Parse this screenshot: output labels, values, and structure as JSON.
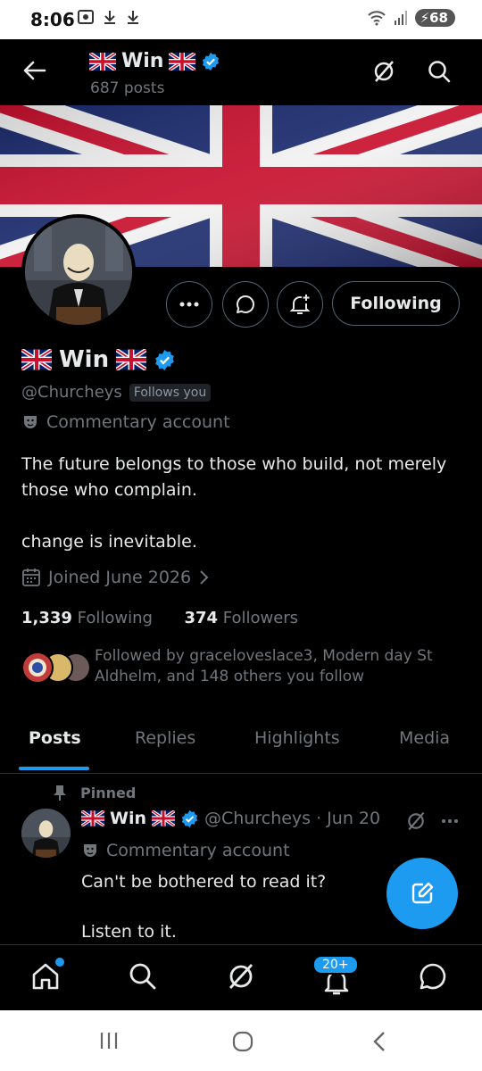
{
  "status_bar": {
    "time": "8:06",
    "battery": "68",
    "icons": [
      "screenshot-icon",
      "download-icon",
      "download-icon",
      "wifi-icon",
      "signal-icon",
      "battery-icon"
    ]
  },
  "header": {
    "name": "Win",
    "posts_count": "687 posts"
  },
  "profile": {
    "display_name": "Win",
    "handle": "@Churcheys",
    "follows_you": "Follows you",
    "category": "Commentary account",
    "bio_line1": "The future belongs to those who build, not merely those who complain.",
    "bio_line2": "change is inevitable.",
    "joined": "Joined June 2026",
    "following_count": "1,339",
    "following_label": "Following",
    "followers_count": "374",
    "followers_label": "Followers",
    "followed_by": "Followed by graceloveslace3, Modern day St Aldhelm, and 148 others you follow"
  },
  "actions": {
    "following_button": "Following"
  },
  "tabs": [
    {
      "label": "Posts",
      "active": true
    },
    {
      "label": "Replies",
      "active": false
    },
    {
      "label": "Highlights",
      "active": false
    },
    {
      "label": "Media",
      "active": false
    }
  ],
  "post": {
    "pinned_label": "Pinned",
    "name": "Win",
    "handle_date": "@Churcheys · Jun 20",
    "category": "Commentary account",
    "text_line1": "Can't be bothered to read it?",
    "text_line2": "Listen to it."
  },
  "bottom_nav": {
    "notifications_badge": "20+"
  },
  "colors": {
    "accent": "#1d9bf0",
    "background": "#000000",
    "muted_text": "#71767b"
  }
}
